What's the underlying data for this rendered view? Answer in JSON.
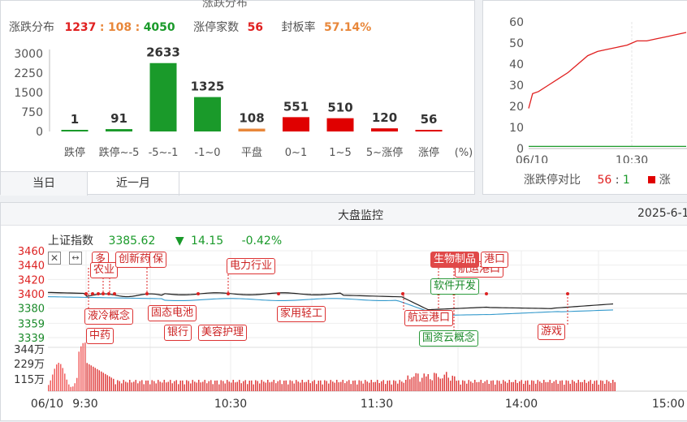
{
  "dist": {
    "title": "涨跌分布",
    "tab_title_partial": "涨跌分布",
    "up": "1237",
    "flat": "108",
    "down": "4050",
    "limit_label": "涨停家数",
    "limit_count": "56",
    "seal_label": "封板率",
    "seal_rate": "57.14%",
    "tabs": [
      "当日",
      "近一月"
    ]
  },
  "chart_data": [
    {
      "type": "bar",
      "categories": [
        "跌停",
        "跌停~-5",
        "-5~-1",
        "-1~0",
        "平盘",
        "0~1",
        "1~5",
        "5~涨停",
        "涨停"
      ],
      "values": [
        1,
        91,
        2633,
        1325,
        108,
        551,
        510,
        120,
        56
      ],
      "colors": [
        "#1a9a2a",
        "#1a9a2a",
        "#1a9a2a",
        "#1a9a2a",
        "#e8873a",
        "#e00000",
        "#e00000",
        "#e00000",
        "#e00000"
      ],
      "ylim": [
        0,
        3000
      ],
      "yticks": [
        "3000",
        "2250",
        "1500",
        "750",
        "0"
      ],
      "unit": "(%)"
    },
    {
      "type": "line",
      "x_ticks": [
        "06/10",
        "10:30"
      ],
      "y_ticks": [
        "60",
        "50",
        "40",
        "30",
        "20",
        "10",
        "0"
      ],
      "ylim": [
        0,
        60
      ],
      "series": [
        {
          "color": "#e02020",
          "x": [
            0,
            2,
            5,
            10,
            15,
            20,
            25,
            30,
            35,
            40,
            45,
            50,
            55,
            60,
            65,
            70,
            75,
            80
          ],
          "values": [
            19,
            26,
            27,
            30,
            33,
            36,
            40,
            44,
            46,
            47,
            48,
            49,
            51,
            51,
            52,
            53,
            54,
            55
          ]
        },
        {
          "color": "#1a9a2a",
          "x": [
            0,
            80
          ],
          "values": [
            1,
            1
          ]
        }
      ]
    }
  ],
  "ratio": {
    "label": "涨跌停对比",
    "up": "56",
    "down": "1",
    "legend_partial": "涨"
  },
  "market": {
    "title": "大盘监控",
    "date_partial": "2025-6-1",
    "index_name": "上证指数",
    "price": "3385.62",
    "change": "14.15",
    "pct": "-0.42%",
    "price_ticks": [
      "3460",
      "3440",
      "3420",
      "3400",
      "3380",
      "3359",
      "3339"
    ],
    "vol_ticks": [
      "344万",
      "229万",
      "115万"
    ],
    "time_ticks": [
      "06/10",
      "9:30",
      "10:30",
      "11:30",
      "14:00",
      "15:00"
    ],
    "tags": {
      "t_duo": "多",
      "t_nongye": "农业",
      "t_chuangxinyao": "创新药",
      "t_huabao": "保",
      "t_diantong": "电力行业",
      "t_yeleng": "液冷概念",
      "t_zhongyao": "中药",
      "t_gutai": "固态电池",
      "t_yinhang": "银行",
      "t_meirong": "美容护理",
      "t_jiayong": "家用轻工",
      "t_shengwu": "生物制品",
      "t_gangkou": "港口",
      "t_hangyun1": "航运港口",
      "t_ruanjian": "软件开发",
      "t_guozi": "国资云概念",
      "t_youxi": "游戏"
    }
  }
}
